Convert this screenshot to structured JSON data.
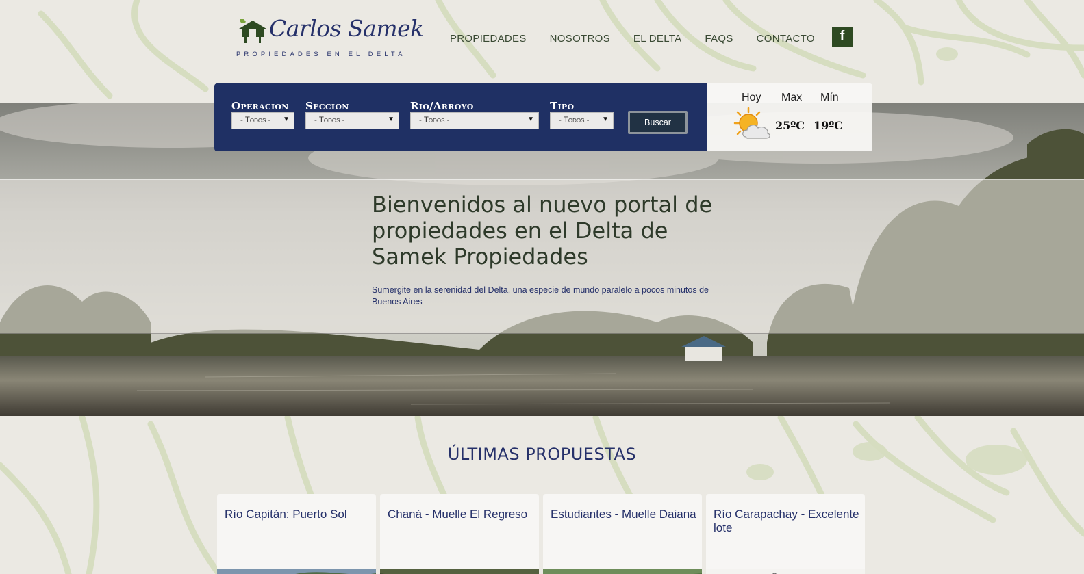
{
  "logo": {
    "name": "Carlos Samek",
    "tagline": "Propiedades en el Delta"
  },
  "nav": {
    "items": [
      "PROPIEDADES",
      "NOSOTROS",
      "EL DELTA",
      "FAQS",
      "CONTACTO"
    ],
    "social_icon": "facebook-icon",
    "social_glyph": "f"
  },
  "search": {
    "fields": [
      {
        "label": "Operacion",
        "value": "- Todos -"
      },
      {
        "label": "Seccion",
        "value": "- Todos -"
      },
      {
        "label": "Rio/Arroyo",
        "value": "- Todos -"
      },
      {
        "label": "Tipo",
        "value": "- Todos -"
      }
    ],
    "button": "Buscar"
  },
  "weather": {
    "hoy_label": "Hoy",
    "max_label": "Max",
    "min_label": "Mín",
    "max": "25ºC",
    "min": "19ºC",
    "icon": "partly-cloudy-icon"
  },
  "hero": {
    "title": "Bienvenidos al nuevo portal de propiedades en el Delta de Samek Propiedades",
    "subtitle": "Sumergite en la serenidad del Delta, una especie de mundo paralelo a pocos minutos de Buenos Aires"
  },
  "ultimas": {
    "heading": "ÚLTIMAS PROPUESTAS",
    "cards": [
      {
        "title": "Río Capitán: Puerto Sol"
      },
      {
        "title": "Chaná - Muelle El Regreso"
      },
      {
        "title": "Estudiantes - Muelle Daiana"
      },
      {
        "title": "Río Carapachay - Excelente lote"
      }
    ]
  },
  "colors": {
    "page_bg": "#ebe9e3",
    "map_lines": "#d4dcbc",
    "navy": "#1f3064",
    "brand_green": "#2e4a22"
  }
}
